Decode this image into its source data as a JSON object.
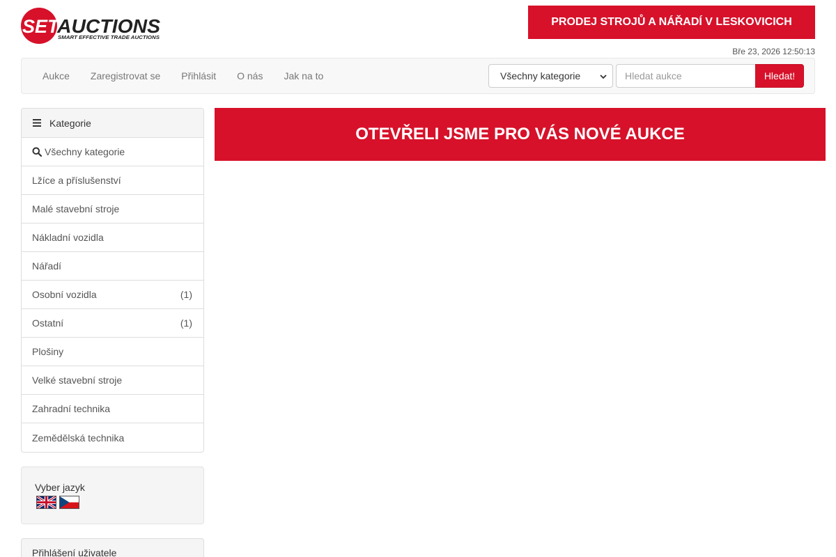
{
  "brand": {
    "logo_mark": "SET",
    "logo_word": "AUCTIONS",
    "logo_tagline": "SMART EFFECTIVE TRADE AUCTIONS",
    "accent_color": "#d7112a"
  },
  "header": {
    "promo_label": "PRODEJ STROJŮ A NÁŘADÍ V LESKOVICICH",
    "datetime": "Bře 23, 2026 12:50:13"
  },
  "nav": {
    "links": [
      "Aukce",
      "Zaregistrovat se",
      "Přihlásit",
      "O nás",
      "Jak na to"
    ],
    "category_select": "Všechny kategorie",
    "search_placeholder": "Hledat aukce",
    "search_button": "Hledat!"
  },
  "sidebar": {
    "heading": "Kategorie",
    "heading_icon": "bars-icon",
    "all_label": "Všechny kategorie",
    "categories": [
      {
        "label": "Lžíce a příslušenství",
        "count": ""
      },
      {
        "label": "Malé stavební stroje",
        "count": ""
      },
      {
        "label": "Nákladní vozidla",
        "count": ""
      },
      {
        "label": "Nářadí",
        "count": ""
      },
      {
        "label": "Osobní vozidla",
        "count": "(1)"
      },
      {
        "label": "Ostatní",
        "count": "(1)"
      },
      {
        "label": "Plošiny",
        "count": ""
      },
      {
        "label": "Velké stavební stroje",
        "count": ""
      },
      {
        "label": "Zahradní technika",
        "count": ""
      },
      {
        "label": "Zemědělská technika",
        "count": ""
      }
    ],
    "language_label": "Vyber jazyk",
    "languages": [
      "english-flag-icon",
      "czech-flag-icon"
    ],
    "login_heading": "Přihlášení uživatele"
  },
  "main": {
    "banner": "OTEVŘELI JSME PRO VÁS NOVÉ AUKCE"
  }
}
